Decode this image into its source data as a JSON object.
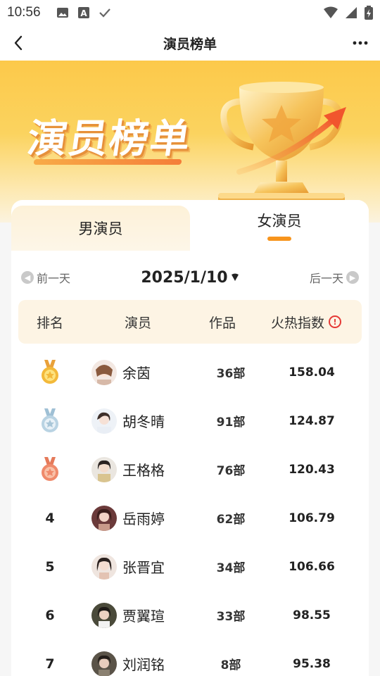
{
  "status_bar": {
    "time": "10:56",
    "left_icons": [
      "image-icon",
      "font-a-icon",
      "check-icon"
    ],
    "right_icons": [
      "wifi-icon",
      "signal-icon",
      "battery-icon"
    ]
  },
  "nav": {
    "title": "演员榜单",
    "back_icon": "chevron-left-icon",
    "more_icon": "more-dots-icon"
  },
  "banner": {
    "title": "演员榜单",
    "illustration": "trophy-icon"
  },
  "tabs": [
    {
      "label": "男演员",
      "active": false
    },
    {
      "label": "女演员",
      "active": true
    }
  ],
  "date_nav": {
    "prev_label": "前一天",
    "date": "2025/1/10",
    "next_label": "后一天"
  },
  "table": {
    "headers": {
      "rank": "排名",
      "actor": "演员",
      "works": "作品",
      "heat": "火热指数"
    },
    "rows": [
      {
        "rank": "1",
        "medal": "gold",
        "name": "余茵",
        "works": "36部",
        "heat": "158.04"
      },
      {
        "rank": "2",
        "medal": "silver",
        "name": "胡冬晴",
        "works": "91部",
        "heat": "124.87"
      },
      {
        "rank": "3",
        "medal": "bronze",
        "name": "王格格",
        "works": "76部",
        "heat": "120.43"
      },
      {
        "rank": "4",
        "medal": "",
        "name": "岳雨婷",
        "works": "62部",
        "heat": "106.79"
      },
      {
        "rank": "5",
        "medal": "",
        "name": "张晋宜",
        "works": "34部",
        "heat": "106.66"
      },
      {
        "rank": "6",
        "medal": "",
        "name": "贾翼瑄",
        "works": "33部",
        "heat": "98.55"
      },
      {
        "rank": "7",
        "medal": "",
        "name": "刘润铭",
        "works": "8部",
        "heat": "95.38"
      }
    ]
  },
  "colors": {
    "accent": "#f7941d",
    "banner_top": "#fcc94a",
    "header_bg": "#fdf4e4",
    "gold": "#f3b93a",
    "silver": "#a9c6d8",
    "bronze": "#ef8a6b",
    "alert": "#e53935"
  }
}
